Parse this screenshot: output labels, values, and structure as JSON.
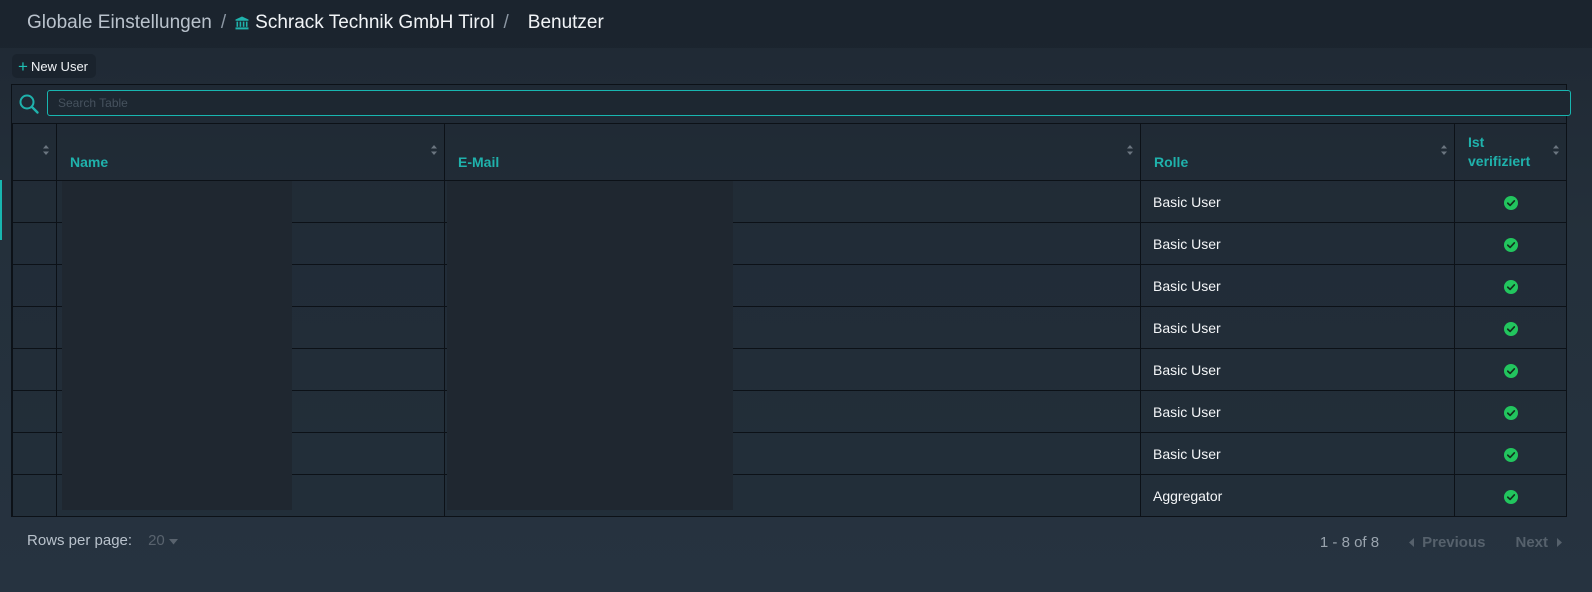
{
  "breadcrumb": {
    "root": "Globale Einstellungen",
    "separator": "/",
    "organization": "Schrack Technik GmbH Tirol",
    "organization_icon": "institution-icon",
    "current": "Benutzer"
  },
  "toolbar": {
    "new_user_label": "New User",
    "new_user_icon": "plus-icon"
  },
  "search": {
    "placeholder": "Search Table",
    "value": "",
    "icon": "search-icon"
  },
  "table": {
    "columns": [
      {
        "key": "select",
        "label": ""
      },
      {
        "key": "name",
        "label": "Name"
      },
      {
        "key": "email",
        "label": "E-Mail"
      },
      {
        "key": "role",
        "label": "Rolle"
      },
      {
        "key": "verified",
        "label": "Ist verifiziert"
      }
    ],
    "rows": [
      {
        "role": "Basic User",
        "verified": true
      },
      {
        "role": "Basic User",
        "verified": true
      },
      {
        "role": "Basic User",
        "verified": true
      },
      {
        "role": "Basic User",
        "verified": true
      },
      {
        "role": "Basic User",
        "verified": true
      },
      {
        "role": "Basic User",
        "verified": true
      },
      {
        "role": "Basic User",
        "verified": true
      },
      {
        "role": "Aggregator",
        "verified": true
      }
    ]
  },
  "footer": {
    "rows_per_page_label": "Rows per page:",
    "rows_per_page_value": "20",
    "range": "1 - 8 of 8",
    "previous": "Previous",
    "next": "Next"
  },
  "colors": {
    "accent": "#1fb2ac",
    "background": "#232e39",
    "verified": "#22c55e",
    "redaction": "#1f2730"
  }
}
